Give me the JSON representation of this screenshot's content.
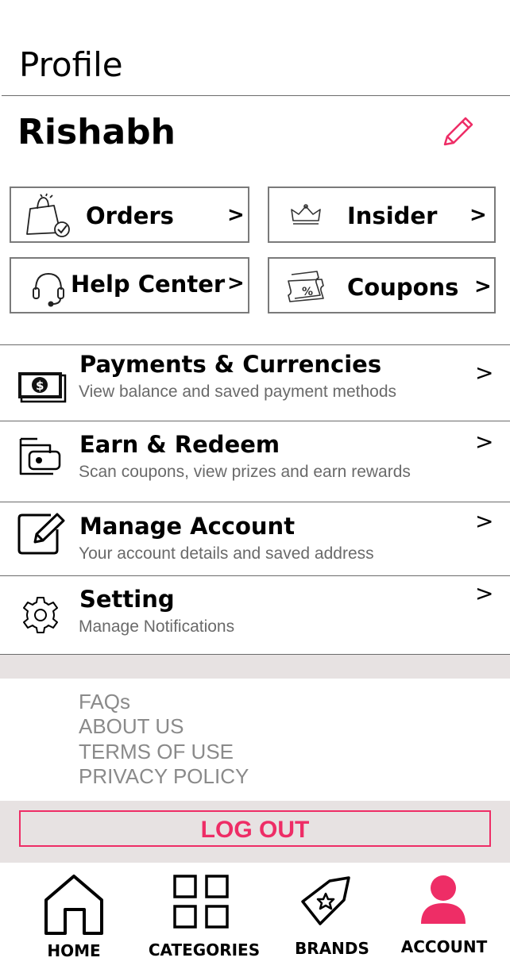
{
  "header": {
    "title": "Profile"
  },
  "user": {
    "name": "Rishabh"
  },
  "quick_links": [
    {
      "label": "Orders",
      "chevron": ">",
      "icon": "shopping-bag-icon"
    },
    {
      "label": "Insider",
      "chevron": ">",
      "icon": "crown-icon"
    },
    {
      "label": "Help Center",
      "chevron": ">",
      "icon": "headset-icon"
    },
    {
      "label": "Coupons",
      "chevron": ">",
      "icon": "coupon-icon"
    }
  ],
  "menu": [
    {
      "title": "Payments & Currencies",
      "subtitle": "View balance and saved payment methods",
      "chevron": ">",
      "icon": "cash-icon"
    },
    {
      "title": "Earn & Redeem",
      "subtitle": "Scan coupons, view prizes and earn rewards",
      "chevron": ">",
      "icon": "wallet-icon"
    },
    {
      "title": "Manage Account",
      "subtitle": "Your account details and saved address",
      "chevron": ">",
      "icon": "edit-square-icon"
    },
    {
      "title": "Setting",
      "subtitle": "Manage Notifications",
      "chevron": ">",
      "icon": "gear-icon"
    }
  ],
  "footer_links": [
    "FAQs",
    "ABOUT US",
    "TERMS OF USE",
    "PRIVACY POLICY"
  ],
  "logout": {
    "label": "LOG OUT"
  },
  "bottom_nav": [
    {
      "label": "HOME",
      "icon": "home-icon"
    },
    {
      "label": "CATEGORIES",
      "icon": "grid-icon"
    },
    {
      "label": "BRANDS",
      "icon": "tag-icon"
    },
    {
      "label": "ACCOUNT",
      "icon": "user-icon",
      "active": true
    }
  ],
  "colors": {
    "accent": "#ee2d66",
    "muted_text": "#6a6a6a",
    "footer_text": "#8a8a8a",
    "band": "#e7e2e2"
  }
}
